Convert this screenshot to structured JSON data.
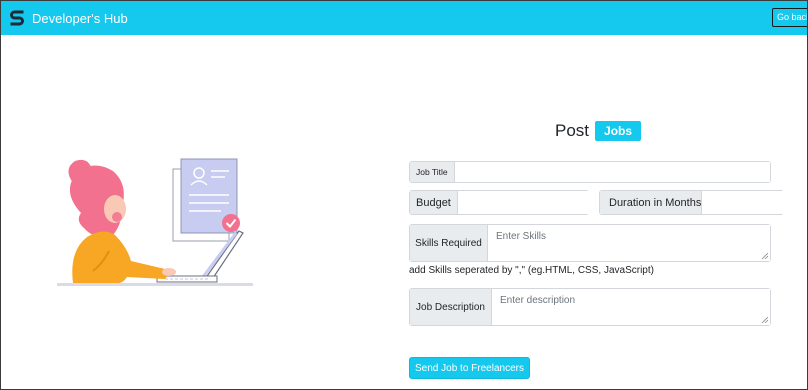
{
  "navbar": {
    "brand": "Developer's Hub",
    "go_back": "Go back"
  },
  "form": {
    "title_prefix": "Post",
    "title_badge": "Jobs",
    "job_title_label": "Job Title",
    "job_title_value": "",
    "budget_label": "Budget",
    "budget_value": "",
    "currency_symbol": "£",
    "duration_label": "Duration in Months",
    "duration_value": "",
    "skills_label": "Skills Required",
    "skills_placeholder": "Enter Skills",
    "skills_hint": "add Skills seperated by \",\" (eg.HTML, CSS, JavaScript)",
    "description_label": "Job Description",
    "description_placeholder": "Enter description",
    "submit_label": "Send Job to Freelancers"
  },
  "colors": {
    "primary": "#14c8ee",
    "addon_bg": "#e9ecef",
    "border": "#d3d7db",
    "hair": "#f2718e",
    "sweater": "#f7a723",
    "document": "#c7ccf0",
    "check": "#f2718e"
  },
  "icons": {
    "brand": "brand-s-logo-icon",
    "duration": "clock-icon"
  }
}
